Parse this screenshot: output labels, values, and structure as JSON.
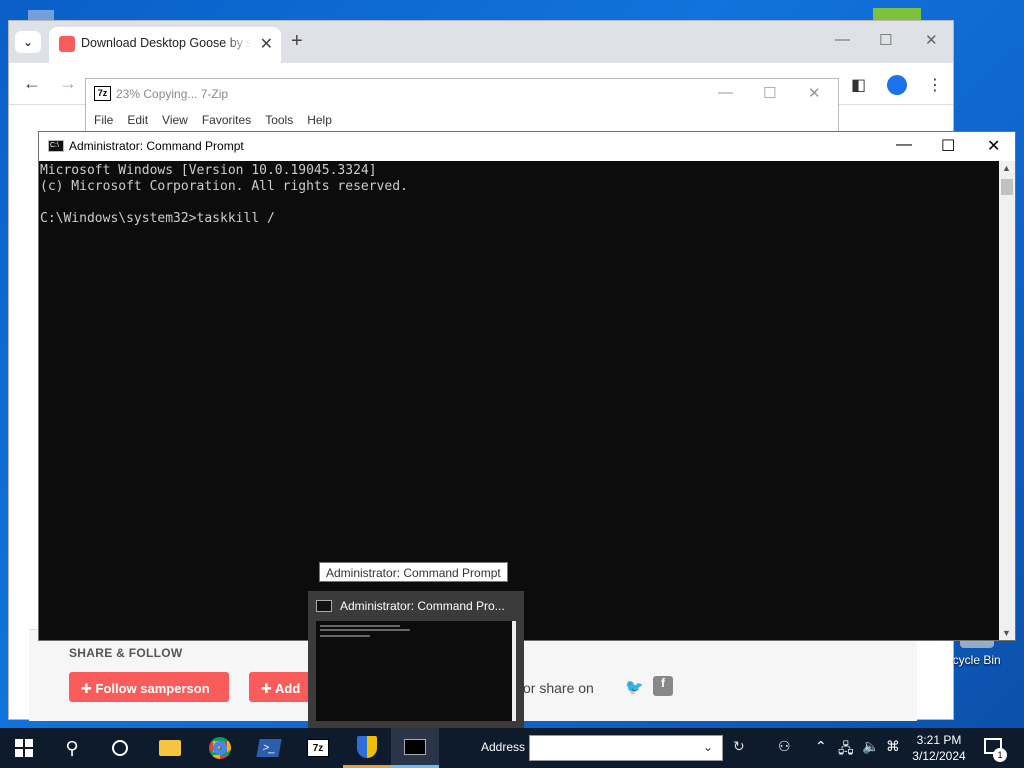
{
  "desktop": {
    "recycle_bin_label": "ecycle Bin"
  },
  "chrome": {
    "tab_title": "Download Desktop Goose by samperson",
    "tab_close": "✕",
    "new_tab": "+",
    "minimize": "—",
    "maximize": "☐",
    "close": "✕",
    "back": "←",
    "forward": "→",
    "page": {
      "share_heading": "SHARE & FOLLOW",
      "follow_button": "Follow samperson",
      "add_button": "Add",
      "share_on": "or share on",
      "twitter_icon": "twitter",
      "facebook_icon": "f"
    }
  },
  "sevenzip": {
    "icon_text": "7z",
    "title": "23% Copying... 7-Zip",
    "menu": [
      "File",
      "Edit",
      "View",
      "Favorites",
      "Tools",
      "Help"
    ]
  },
  "cmd": {
    "icon_text": "C:\\",
    "title": "Administrator: Command Prompt",
    "lines": [
      "Microsoft Windows [Version 10.0.19045.3324]",
      "(c) Microsoft Corporation. All rights reserved.",
      "",
      "C:\\Windows\\system32>taskkill /"
    ]
  },
  "taskbar_popup": {
    "tooltip": "Administrator: Command Prompt",
    "preview_title": "Administrator: Command Pro..."
  },
  "taskbar": {
    "address_label": "Address",
    "address_value": "",
    "clock_time": "3:21 PM",
    "clock_date": "3/12/2024",
    "notification_count": "1"
  }
}
